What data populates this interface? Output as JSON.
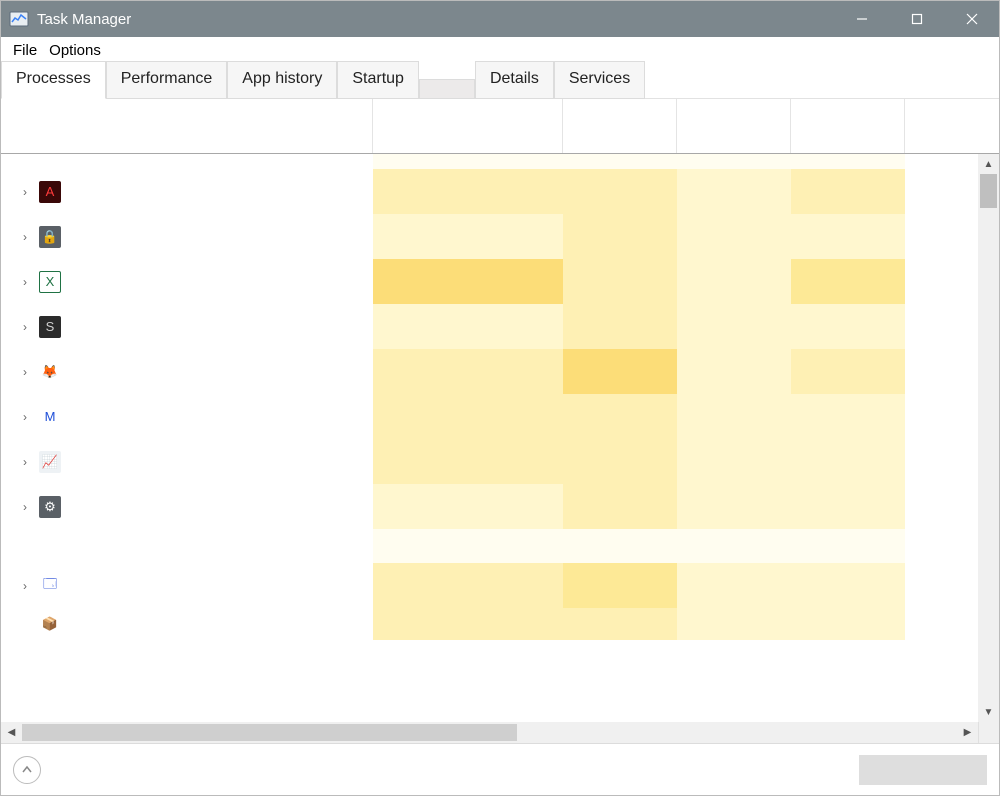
{
  "window": {
    "title": "Task Manager"
  },
  "menu": {
    "file": "File",
    "options": "Options"
  },
  "tabs": [
    {
      "label": "Processes",
      "active": true
    },
    {
      "label": "Performance",
      "active": false
    },
    {
      "label": "App history",
      "active": false
    },
    {
      "label": "Startup",
      "active": false
    },
    {
      "label": "",
      "active": false,
      "blank": true
    },
    {
      "label": "Details",
      "active": false
    },
    {
      "label": "Services",
      "active": false
    }
  ],
  "processes": [
    {
      "icon": "adobe-acrobat-icon",
      "expandable": true,
      "heat": [
        "h2",
        "h2",
        "h1",
        "h2"
      ]
    },
    {
      "icon": "lock-app-icon",
      "expandable": true,
      "heat": [
        "h1",
        "h2",
        "h1",
        "h1"
      ]
    },
    {
      "icon": "excel-icon",
      "expandable": true,
      "heat": [
        "h4",
        "h2",
        "h1",
        "h3"
      ]
    },
    {
      "icon": "speccy-icon",
      "expandable": true,
      "heat": [
        "h1",
        "h2",
        "h1",
        "h1"
      ]
    },
    {
      "icon": "firefox-icon",
      "expandable": true,
      "heat": [
        "h2",
        "h4",
        "h1",
        "h2"
      ]
    },
    {
      "icon": "malwarebytes-icon",
      "expandable": true,
      "heat": [
        "h2",
        "h2",
        "h1",
        "h1"
      ]
    },
    {
      "icon": "task-manager-icon",
      "expandable": true,
      "heat": [
        "h2",
        "h2",
        "h1",
        "h1"
      ]
    },
    {
      "icon": "settings-icon",
      "expandable": true,
      "heat": [
        "h1",
        "h2",
        "h1",
        "h1"
      ]
    },
    {
      "icon": "",
      "expandable": false,
      "heat": [
        "h0",
        "h0",
        "h0",
        "h0"
      ],
      "empty": true
    },
    {
      "icon": "explorer-window-icon",
      "expandable": true,
      "heat": [
        "h2",
        "h3",
        "h1",
        "h1"
      ]
    },
    {
      "icon": "wampserver-icon",
      "expandable": false,
      "heat": [
        "h2",
        "h2",
        "h1",
        "h1"
      ],
      "short": true
    }
  ],
  "icons": {
    "adobe-acrobat-icon": {
      "bg": "#3a0808",
      "fg": "#ff3b3b",
      "glyph": "A"
    },
    "lock-app-icon": {
      "bg": "#5a6066",
      "fg": "#ffffff",
      "glyph": "🔒"
    },
    "excel-icon": {
      "bg": "#ffffff",
      "fg": "#1f7244",
      "glyph": "X",
      "border": "#1f7244"
    },
    "speccy-icon": {
      "bg": "#2b2b2b",
      "fg": "#d0d0d0",
      "glyph": "S"
    },
    "firefox-icon": {
      "bg": "#ffffff",
      "fg": "#ff7a18",
      "glyph": "🦊"
    },
    "malwarebytes-icon": {
      "bg": "#ffffff",
      "fg": "#1d4ed8",
      "glyph": "M"
    },
    "task-manager-icon": {
      "bg": "#eef2f5",
      "fg": "#5b6b7a",
      "glyph": "📈"
    },
    "settings-icon": {
      "bg": "#5a6066",
      "fg": "#ffffff",
      "glyph": "⚙"
    },
    "explorer-window-icon": {
      "bg": "#ffffff",
      "fg": "#2247d4",
      "glyph": "🗔"
    },
    "wampserver-icon": {
      "bg": "#ffffff",
      "fg": "#d46bd4",
      "glyph": "📦"
    }
  }
}
